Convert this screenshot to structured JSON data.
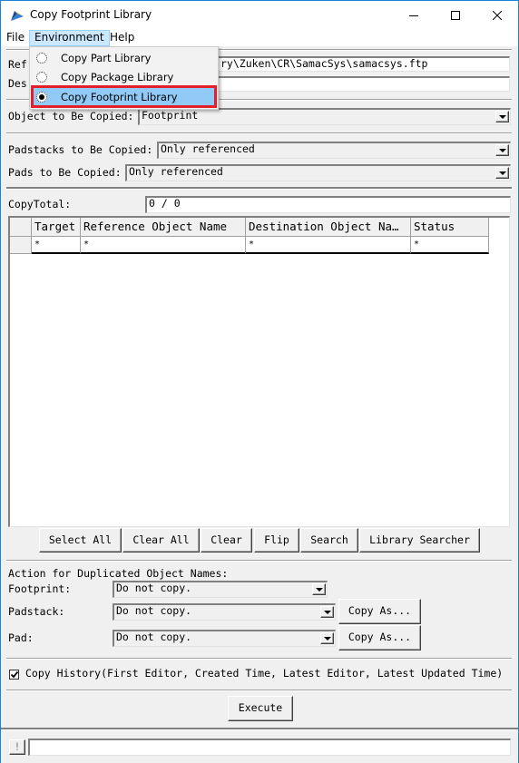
{
  "window": {
    "title": "Copy Footprint Library",
    "app_icon": "copy-library-app-icon",
    "controls": [
      "minimize",
      "maximize",
      "close"
    ]
  },
  "menubar": {
    "items": [
      {
        "label": "File"
      },
      {
        "label": "Environment",
        "open": true
      },
      {
        "label": "Help"
      }
    ]
  },
  "environment_menu": {
    "items": [
      {
        "label": "Copy Part Library",
        "selected": false
      },
      {
        "label": "Copy Package Library",
        "selected": false
      },
      {
        "label": "Copy Footprint Library",
        "selected": true,
        "highlighted": true
      }
    ],
    "annotation_color": "#e3202a"
  },
  "form": {
    "reference_label_visible": "Ref",
    "reference_path_visible": "ry\\Zuken\\CR\\SamacSys\\samacsys.ftp",
    "destination_label_visible": "Des",
    "destination_path": "",
    "object_to_copy_label": "Object to Be Copied:",
    "object_to_copy_value": "Footprint",
    "padstacks_label": "Padstacks to Be Copied:",
    "padstacks_value": "Only referenced",
    "pads_label": "Pads to Be Copied:",
    "pads_value": "Only referenced",
    "copy_total_label": "CopyTotal:",
    "copy_total_value": "0 / 0"
  },
  "grid": {
    "columns": [
      "Target",
      "Reference Object Name",
      "Destination Object Na…",
      "Status"
    ],
    "rows": [
      [
        "*",
        "*",
        "*",
        "*"
      ]
    ]
  },
  "grid_buttons": {
    "select_all": "Select All",
    "clear_all": "Clear All",
    "clear": "Clear",
    "flip": "Flip",
    "search": "Search",
    "library_searcher": "Library Searcher"
  },
  "duplicates": {
    "heading": "Action for Duplicated Object Names:",
    "footprint_label": "Footprint:",
    "footprint_value": "Do not copy.",
    "padstack_label": "Padstack:",
    "padstack_value": "Do not copy.",
    "padstack_copy_as": "Copy As...",
    "pad_label": "Pad:",
    "pad_value": "Do not copy.",
    "pad_copy_as": "Copy As..."
  },
  "copy_history": {
    "label": "Copy History(First Editor, Created Time, Latest Editor, Latest Updated Time)",
    "checked": true
  },
  "execute_label": "Execute",
  "statusbar": {
    "button_label": "!",
    "message": ""
  }
}
